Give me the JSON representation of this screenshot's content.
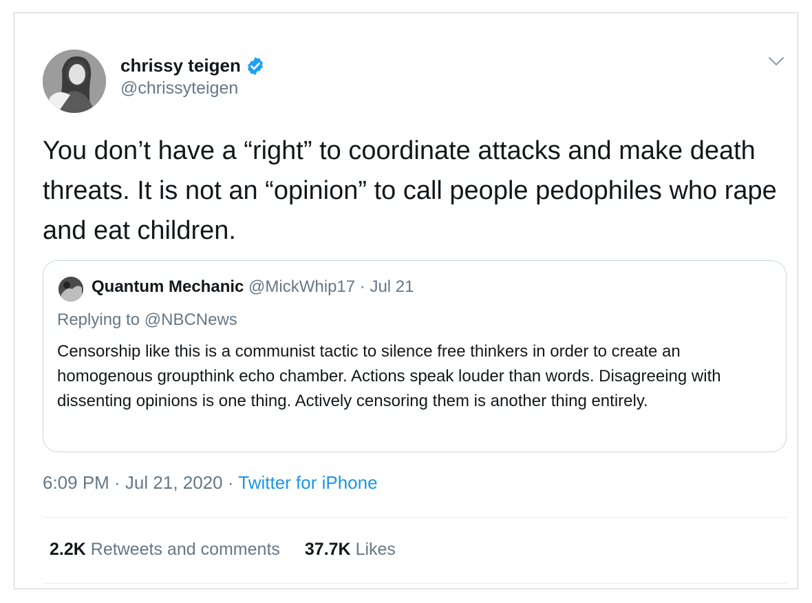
{
  "tweet": {
    "display_name": "chrissy teigen",
    "handle": "@chrissyteigen",
    "verified": true,
    "text": "You don’t have a “right” to coordinate attacks and make death threats. It is not an “opinion” to call people pedophiles who rape and eat children.",
    "timestamp": "6:09 PM · Jul 21, 2020",
    "separator": " · ",
    "source": "Twitter for iPhone",
    "icons": {
      "menu": "chevron-down-icon",
      "verified": "verified-badge-icon"
    }
  },
  "quote": {
    "display_name": "Quantum Mechanic",
    "handle": "@MickWhip17",
    "date": " · Jul 21",
    "replying_label": "Replying to ",
    "replying_to": "@NBCNews",
    "text": "Censorship like this is a communist tactic to silence free thinkers in order to create an homogenous groupthink echo chamber. Actions speak louder than words. Disagreeing with dissenting opinions is one thing. Actively censoring them is another thing entirely."
  },
  "stats": {
    "retweets_count": "2.2K",
    "retweets_label": "Retweets and comments",
    "likes_count": "37.7K",
    "likes_label": "Likes"
  },
  "colors": {
    "text": "#14171a",
    "secondary": "#657786",
    "link": "#1b95e0",
    "verified": "#1da1f2",
    "border": "#ccd6dd"
  }
}
